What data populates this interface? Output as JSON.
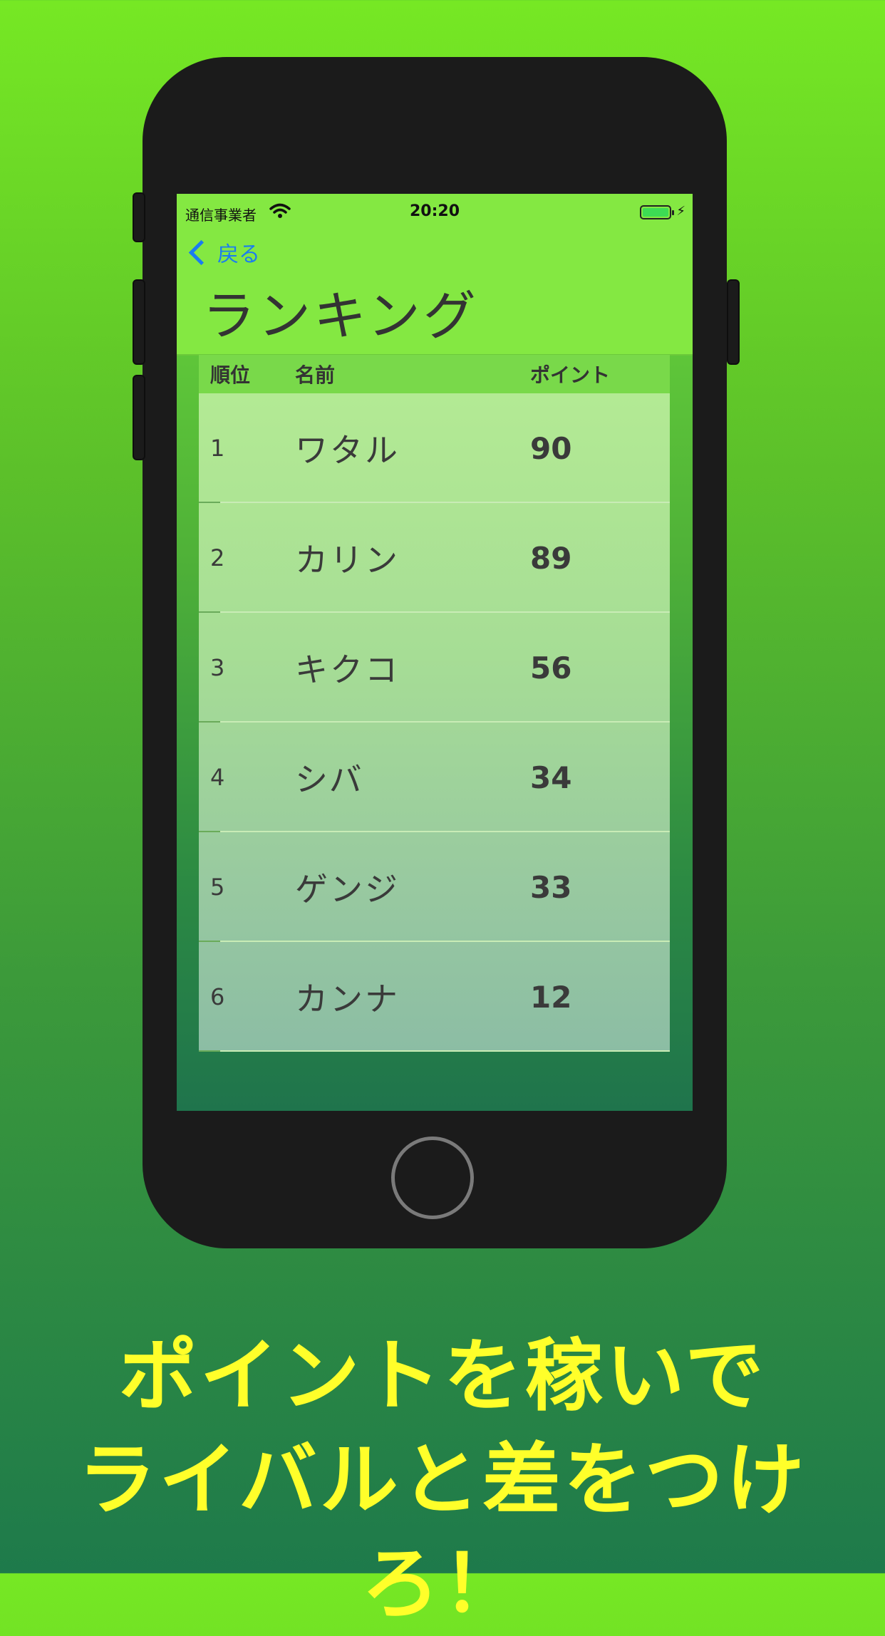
{
  "status_bar": {
    "carrier": "通信事業者",
    "time": "20:20"
  },
  "nav": {
    "back_label": "戻る",
    "title": "ランキング"
  },
  "table": {
    "headers": {
      "rank": "順位",
      "name": "名前",
      "points": "ポイント"
    },
    "rows": [
      {
        "rank": "1",
        "name": "ワタル",
        "points": "90"
      },
      {
        "rank": "2",
        "name": "カリン",
        "points": "89"
      },
      {
        "rank": "3",
        "name": "キクコ",
        "points": "56"
      },
      {
        "rank": "4",
        "name": "シバ",
        "points": "34"
      },
      {
        "rank": "5",
        "name": "ゲンジ",
        "points": "33"
      },
      {
        "rank": "6",
        "name": "カンナ",
        "points": "12"
      }
    ]
  },
  "caption": {
    "line1": "ポイントを稼いで",
    "line2": "ライバルと差をつけろ！"
  },
  "colors": {
    "accent": "#1a7cf0",
    "caption": "#ffff2a",
    "navbar": "#84e842"
  }
}
